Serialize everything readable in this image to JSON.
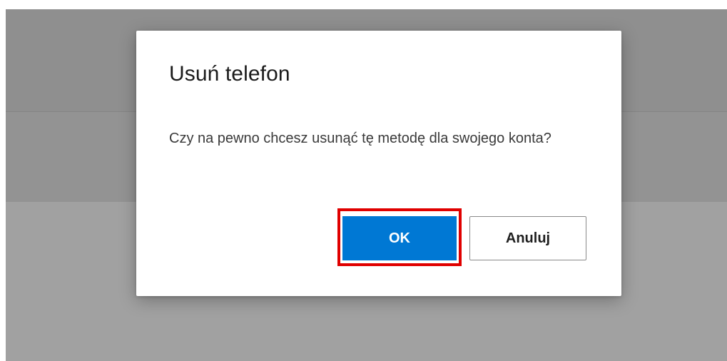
{
  "dialog": {
    "title": "Usuń telefon",
    "message": "Czy na pewno chcesz usunąć tę metodę dla swojego konta?",
    "ok_label": "OK",
    "cancel_label": "Anuluj"
  },
  "colors": {
    "primary_button": "#0078d4",
    "highlight_border": "#e00000",
    "overlay": "#9b9b9b"
  }
}
